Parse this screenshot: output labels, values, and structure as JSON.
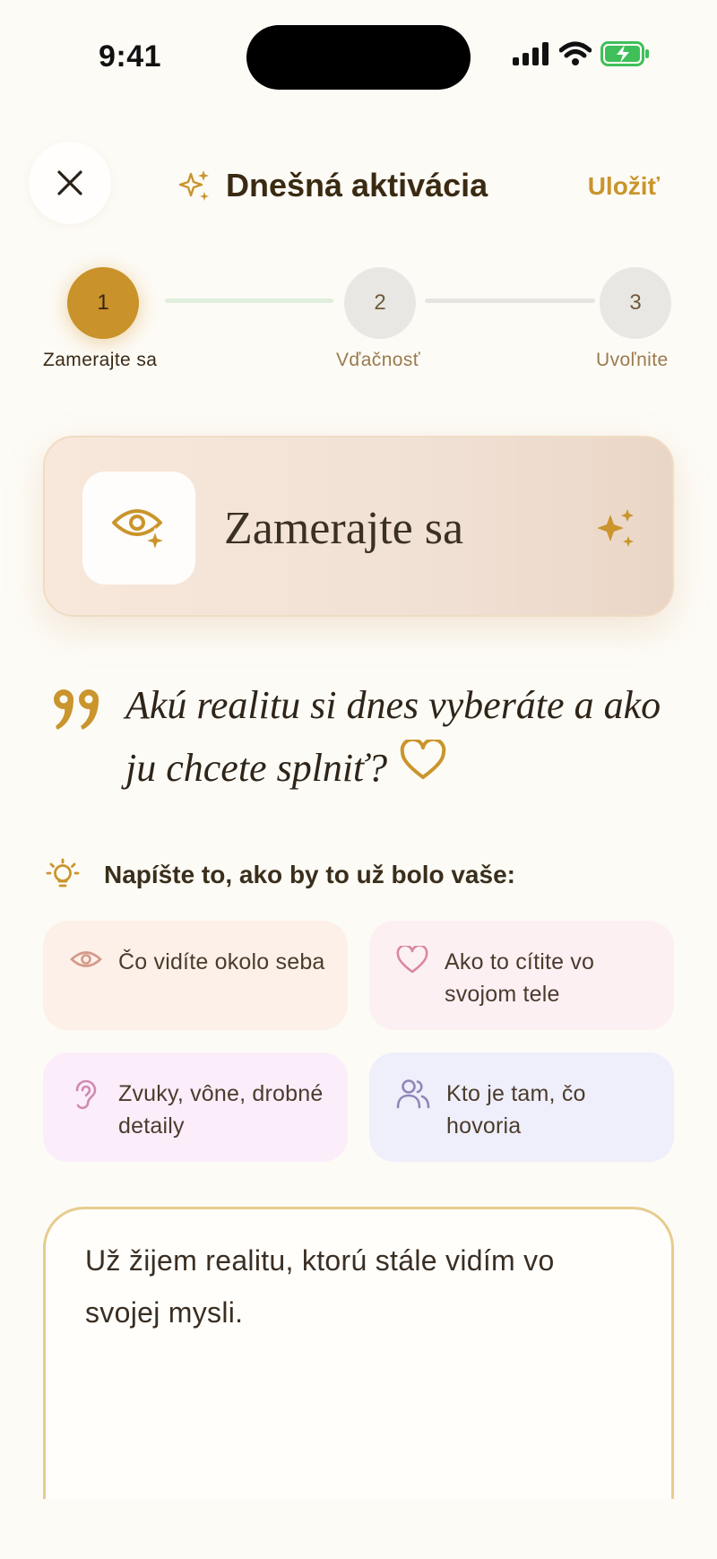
{
  "status": {
    "time": "9:41"
  },
  "header": {
    "title": "Dnešná aktivácia",
    "save_label": "Uložiť"
  },
  "stepper": {
    "current": 1,
    "steps": [
      {
        "number": "1",
        "label": "Zamerajte sa"
      },
      {
        "number": "2",
        "label": "Vďačnosť"
      },
      {
        "number": "3",
        "label": "Uvoľnite"
      }
    ]
  },
  "focus_card": {
    "title": "Zamerajte sa"
  },
  "quote": {
    "text": "Akú realitu si dnes vyberáte a ako ju chcete splniť?"
  },
  "hint": {
    "text": "Napíšte to, ako by to už bolo vaše:"
  },
  "prompts": [
    {
      "text": "Čo vidíte okolo seba",
      "icon": "eye-icon"
    },
    {
      "text": "Ako to cítite vo svojom tele",
      "icon": "heart-icon"
    },
    {
      "text": "Zvuky, vône, drobné detaily",
      "icon": "ear-icon"
    },
    {
      "text": "Kto je tam, čo hovoria",
      "icon": "people-icon"
    }
  ],
  "answer": {
    "value": "Už žijem realitu, ktorú stále vidím vo svojej mysli."
  },
  "colors": {
    "accent": "#c9952c",
    "background": "#fdfbf6",
    "text": "#3a2e1c"
  }
}
